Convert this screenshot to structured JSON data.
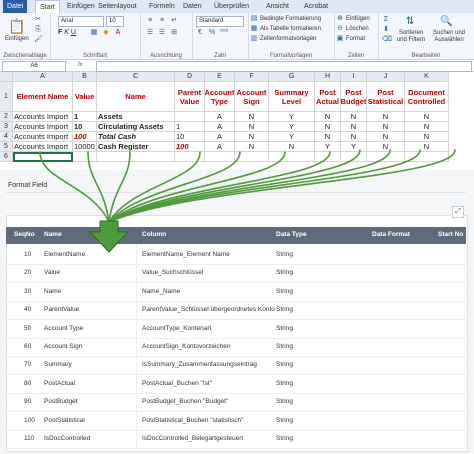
{
  "ribbon": {
    "tabs": [
      "Datei",
      "Start",
      "Einfügen",
      "Seitenlayout",
      "Formeln",
      "Daten",
      "Überprüfen",
      "Ansicht",
      "Acrobat"
    ],
    "paste_label": "Einfügen",
    "font_name": "Arial",
    "font_size": "10",
    "number_format": "Standard",
    "format_items": [
      "Bedingte Formatierung",
      "Als Tabelle formatieren",
      "Zellenformatvorlagen"
    ],
    "cell_items": [
      "Einfügen",
      "Löschen",
      "Format"
    ],
    "edit_items": [
      "Sortieren und Filtern",
      "Suchen und Auswählen"
    ],
    "group_labels": [
      "Zwischenablage",
      "Schriftart",
      "Ausrichtung",
      "Zahl",
      "Formatvorlagen",
      "Zellen",
      "Bearbeiten"
    ]
  },
  "formula_bar": {
    "name_box": "A6",
    "fx": "fx"
  },
  "sheet": {
    "col_letters": [
      "A",
      "B",
      "C",
      "D",
      "E",
      "F",
      "G",
      "H",
      "I",
      "J",
      "K"
    ],
    "row_numbers": [
      "1",
      "2",
      "3",
      "4",
      "5",
      "6"
    ],
    "headers": [
      "Element Name",
      "Value",
      "Name",
      "Parent Value",
      "Account Type",
      "Account Sign",
      "Summary Level",
      "Post Actual",
      "Post Budget",
      "Post Statistical",
      "Document Controlled"
    ],
    "rows": [
      [
        "Accounts Import",
        "1",
        "Assets",
        "",
        "A",
        "N",
        "Y",
        "N",
        "N",
        "N",
        "N"
      ],
      [
        "Accounts Import",
        "10",
        "Circulating Assets",
        "1",
        "A",
        "N",
        "Y",
        "N",
        "N",
        "N",
        "N"
      ],
      [
        "Accounts Import",
        "100",
        "Total Cash",
        "10",
        "A",
        "N",
        "Y",
        "N",
        "N",
        "N",
        "N"
      ],
      [
        "Accounts Import",
        "10000",
        "Cash Register",
        "100",
        "A",
        "N",
        "N",
        "Y",
        "Y",
        "N",
        "N"
      ]
    ]
  },
  "panel": {
    "title": "Format Field",
    "columns": [
      "SeqNo",
      "Name",
      "Column",
      "Data Type",
      "Data Format",
      "Start No"
    ],
    "rows": [
      [
        "10",
        "ElementName",
        "ElementName_Element Name",
        "String"
      ],
      [
        "20",
        "Value",
        "Value_Suchschlüssel",
        "String"
      ],
      [
        "30",
        "Name",
        "Name_Name",
        "String"
      ],
      [
        "40",
        "ParentValue",
        "ParentValue_Schlüssel übergeordnetes Konto",
        "String"
      ],
      [
        "50",
        "Account Type",
        "AccountType_Kontenart",
        "String"
      ],
      [
        "60",
        "Account Sign",
        "AccountSign_Kontovorzeichen",
        "String"
      ],
      [
        "70",
        "Summary",
        "IsSummary_Zusammenfassungseintrag",
        "String"
      ],
      [
        "80",
        "PostActual",
        "PostActual_Buchen \"Ist\"",
        "String"
      ],
      [
        "90",
        "PostBudget",
        "PostBudget_Buchen \"Budget\"",
        "String"
      ],
      [
        "100",
        "PostStatistical",
        "PostStatistical_Buchen \"statistisch\"",
        "String"
      ],
      [
        "110",
        "IsDocControlled",
        "IsDocControlled_Belegartgesteuert",
        "String"
      ]
    ]
  },
  "colors": {
    "arrow": "#4f9a3a",
    "header_red": "#c00000",
    "table_header": "#5f6b7a"
  }
}
